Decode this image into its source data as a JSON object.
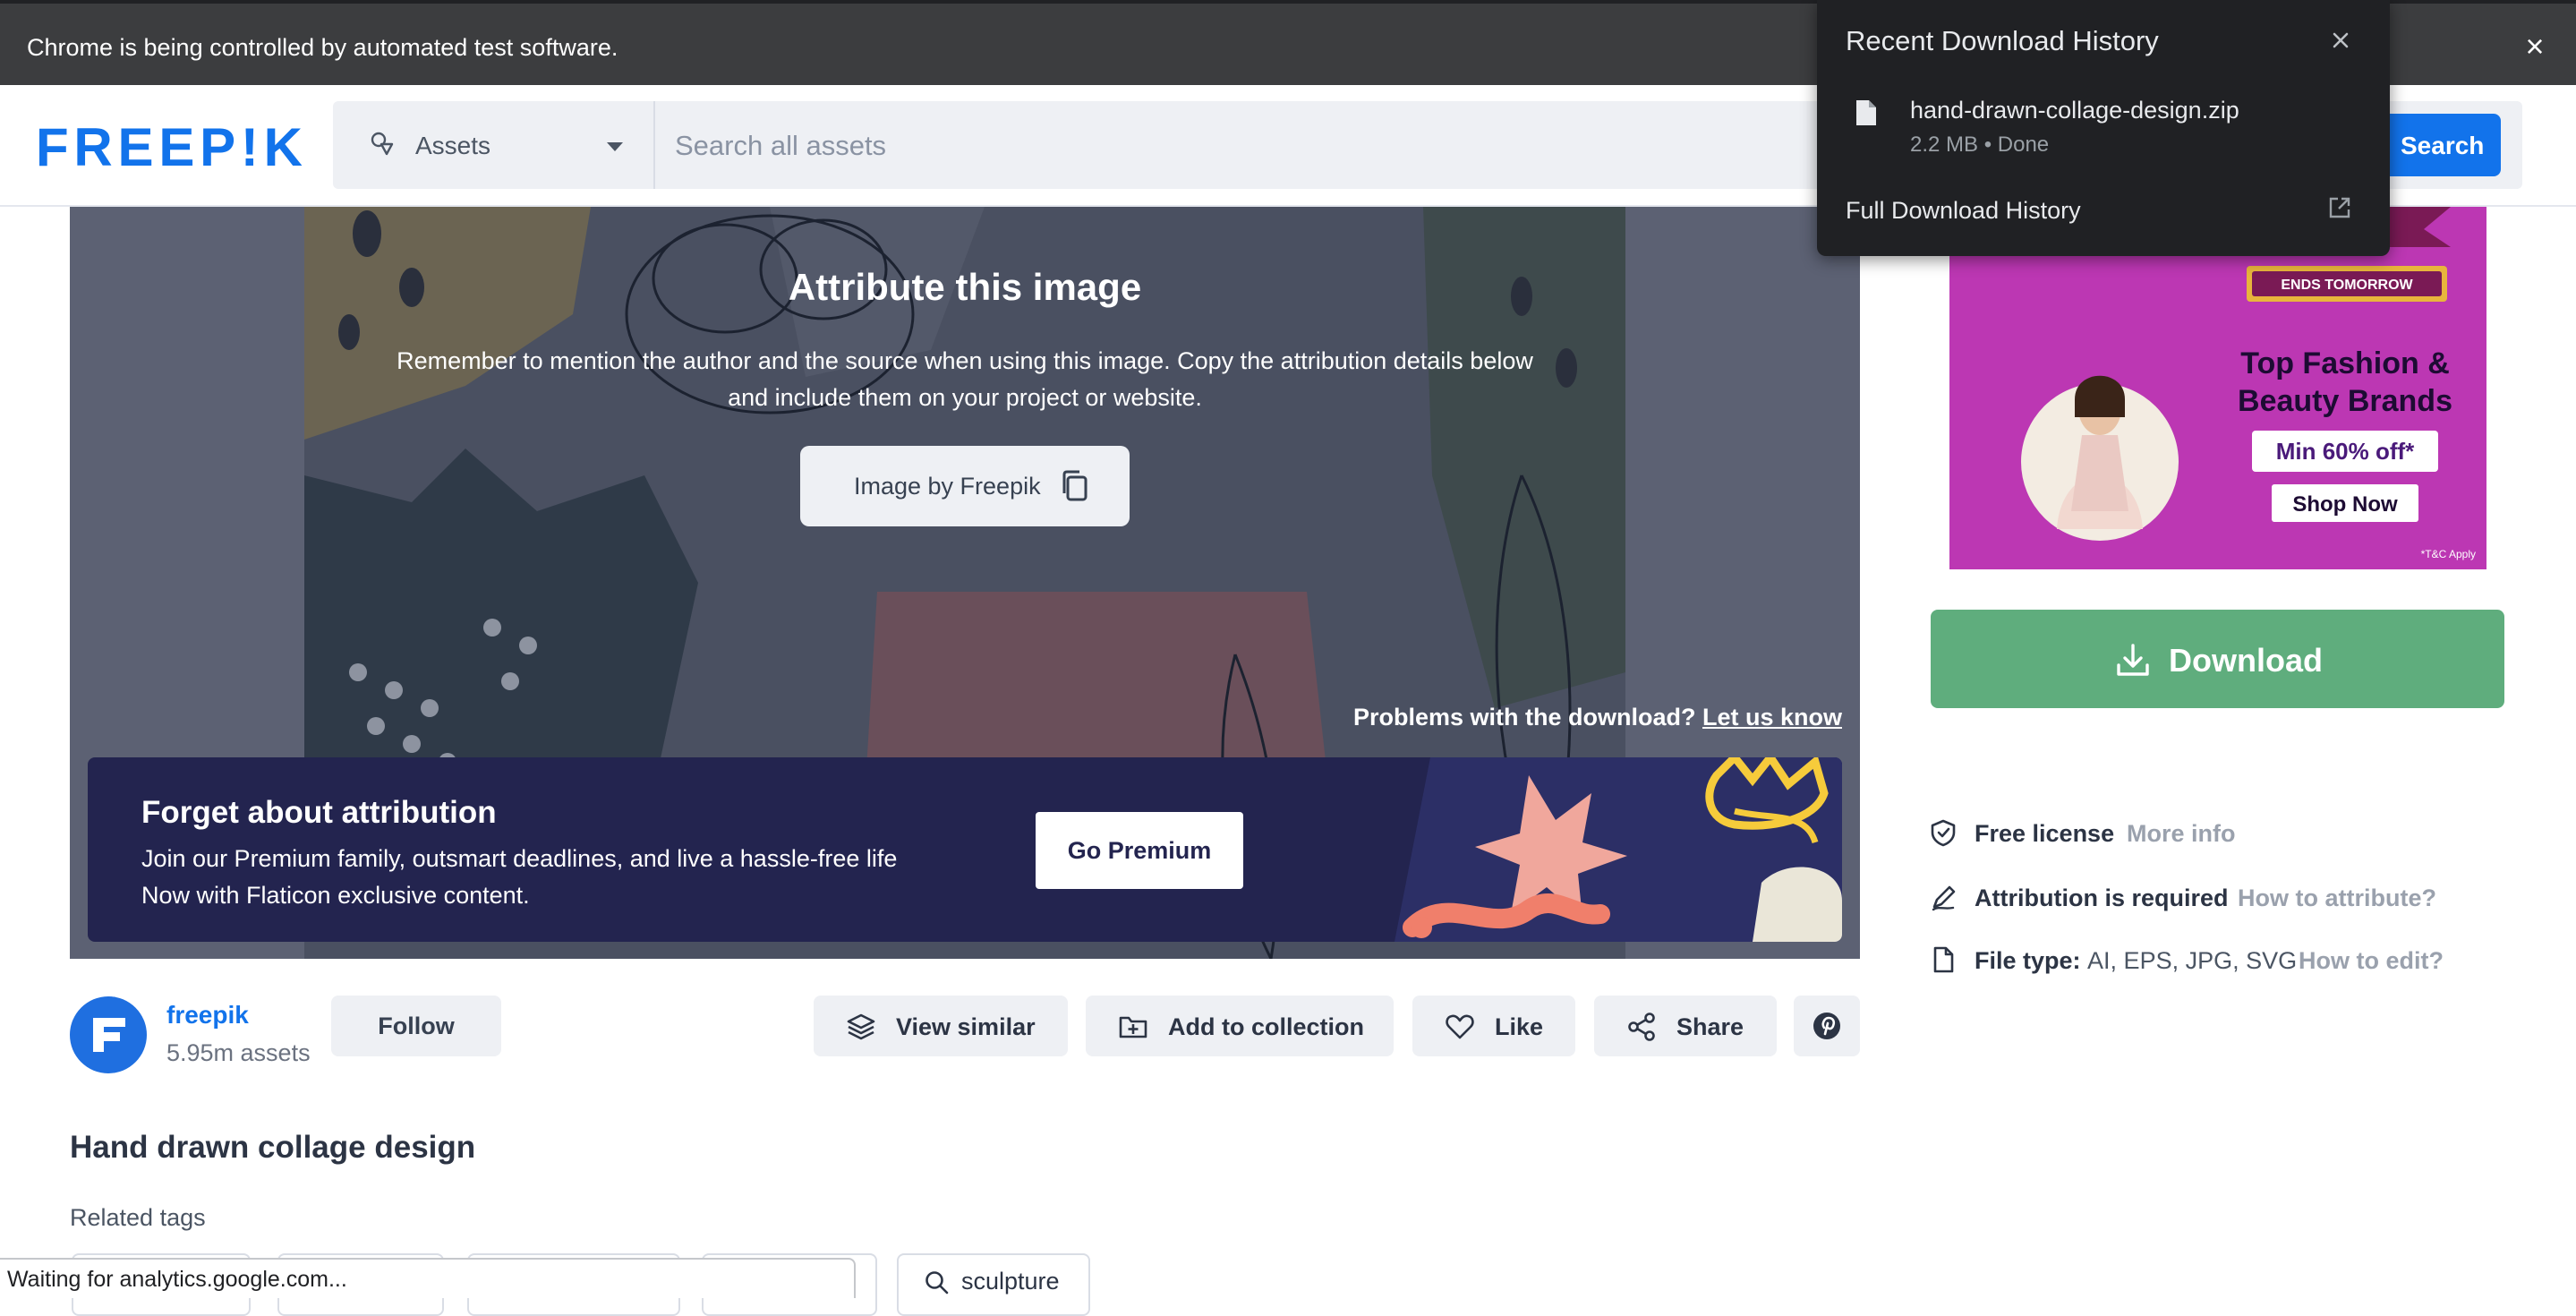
{
  "browser": {
    "automation_message": "Chrome is being controlled by automated test software.",
    "status_text": "Waiting for analytics.google.com..."
  },
  "download_popup": {
    "title": "Recent Download History",
    "file_name": "hand-drawn-collage-design.zip",
    "file_meta": "2.2 MB • Done",
    "full_history_label": "Full Download History"
  },
  "header": {
    "logo_text": "FREEP!K",
    "asset_type_label": "Assets",
    "search_placeholder": "Search all assets",
    "search_button_label": "Search"
  },
  "preview": {
    "attribution_title": "Attribute this image",
    "attribution_desc_line1": "Remember to mention the author and the source when using this image. Copy the attribution details below",
    "attribution_desc_line2": "and include them on your project or website.",
    "attribution_copy_label": "Image by Freepik",
    "problems_text": "Problems with the download?",
    "problems_link": "Let us know"
  },
  "premium_banner": {
    "title": "Forget about attribution",
    "line1": "Join our Premium family, outsmart deadlines, and live a hassle-free life",
    "line2": "Now with Flaticon exclusive content.",
    "button_label": "Go Premium"
  },
  "author": {
    "name": "freepik",
    "assets_count": "5.95m assets",
    "follow_label": "Follow"
  },
  "actions": {
    "view_similar": "View similar",
    "add_to_collection": "Add to collection",
    "like": "Like",
    "share": "Share"
  },
  "asset": {
    "title": "Hand drawn collage design",
    "related_tags_label": "Related tags",
    "tags": [
      "sculpture"
    ]
  },
  "ad": {
    "badge": "ENDS TOMORROW",
    "headline_line1": "Top Fashion &",
    "headline_line2": "Beauty Brands",
    "offer": "Min 60% off*",
    "cta": "Shop Now",
    "fineprint": "*T&C Apply"
  },
  "sidebar": {
    "download_label": "Download",
    "license_label": "Free license",
    "license_link": "More info",
    "attribution_label": "Attribution is required",
    "attribution_link": "How to attribute?",
    "file_type_label": "File type:",
    "file_type_value": "AI, EPS, JPG, SVG",
    "file_type_link": "How to edit?"
  },
  "colors": {
    "brand_blue": "#1273eb",
    "download_green": "#5fad7d",
    "premium_navy": "#23244f",
    "ad_magenta": "#b82fb1"
  }
}
